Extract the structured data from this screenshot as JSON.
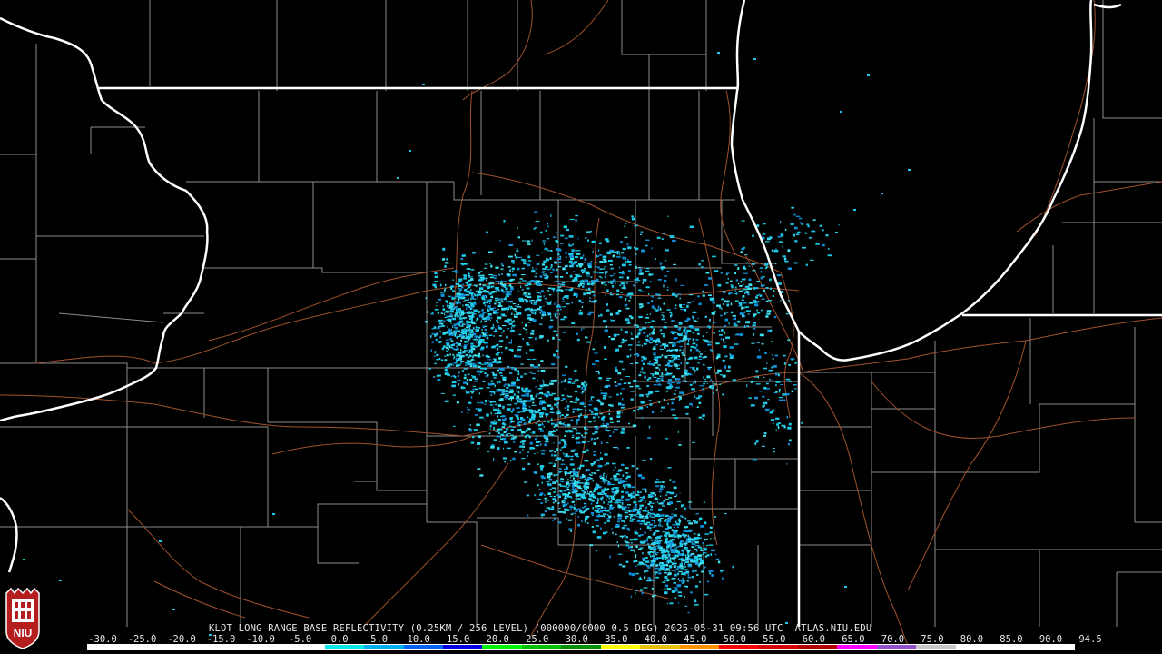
{
  "title": "KLOT LONG RANGE BASE REFLECTIVITY (0.25KM / 256 LEVEL) (000000/0000 0.5 DEG) 2025-05-31 09:56 UTC  ATLAS.NIU.EDU",
  "logo": {
    "text": "NIU",
    "icon": "niu-logo-icon"
  },
  "colorscale": {
    "tick_labels": [
      "-30.0",
      "-25.0",
      "-20.0",
      "-15.0",
      "-10.0",
      "-5.0",
      "0.0",
      "5.0",
      "10.0",
      "15.0",
      "20.0",
      "25.0",
      "30.0",
      "35.0",
      "40.0",
      "45.0",
      "50.0",
      "55.0",
      "60.0",
      "65.0",
      "70.0",
      "75.0",
      "80.0",
      "85.0",
      "90.0",
      "94.5"
    ],
    "segment_colors": [
      "#ffffff",
      "#ffffff",
      "#ffffff",
      "#ffffff",
      "#ffffff",
      "#ffffff",
      "#00e8e8",
      "#00b0f0",
      "#0060f0",
      "#0000e0",
      "#00f000",
      "#00c000",
      "#009000",
      "#ffff00",
      "#e8c000",
      "#ff9000",
      "#ff0000",
      "#d80000",
      "#b00000",
      "#ff00ff",
      "#9050d0",
      "#c8c8c8",
      "#ffffff",
      "#ffffff",
      "#ffffff"
    ]
  },
  "map_style": {
    "background": "#000000",
    "state_border_color": "#ffffff",
    "county_border_color": "#8c8c8c",
    "road_color": "#a0522d",
    "echo_color": "#1ec8e8",
    "echo_dark_color": "#1090d8"
  }
}
